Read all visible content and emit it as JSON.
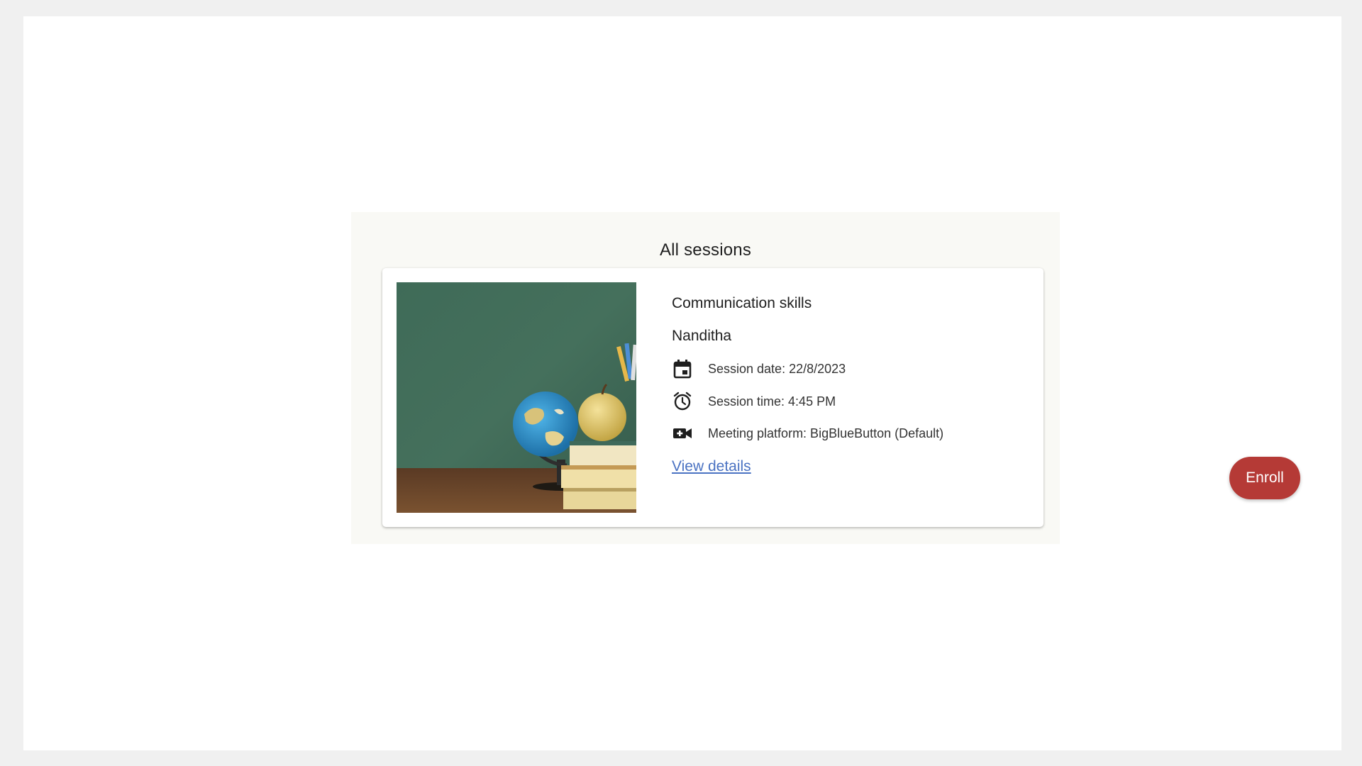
{
  "panel": {
    "title": "All sessions"
  },
  "session": {
    "image_alt": "Globe, apple and stacked books in front of a green chalkboard",
    "title": "Communication skills",
    "facilitator": "Nanditha",
    "date_text": "Session date: 22/8/2023",
    "time_text": "Session time: 4:45 PM",
    "platform_text": "Meeting platform: BigBlueButton (Default)",
    "view_details_label": "View details",
    "enroll_label": "Enroll",
    "icons": {
      "date": "calendar-icon",
      "time": "alarm-clock-icon",
      "platform": "video-camera-icon"
    }
  },
  "colors": {
    "page_background": "#f0f0f0",
    "panel_background": "#f9f9f5",
    "link": "#4a72c2",
    "enroll_button": "#b53a36"
  }
}
